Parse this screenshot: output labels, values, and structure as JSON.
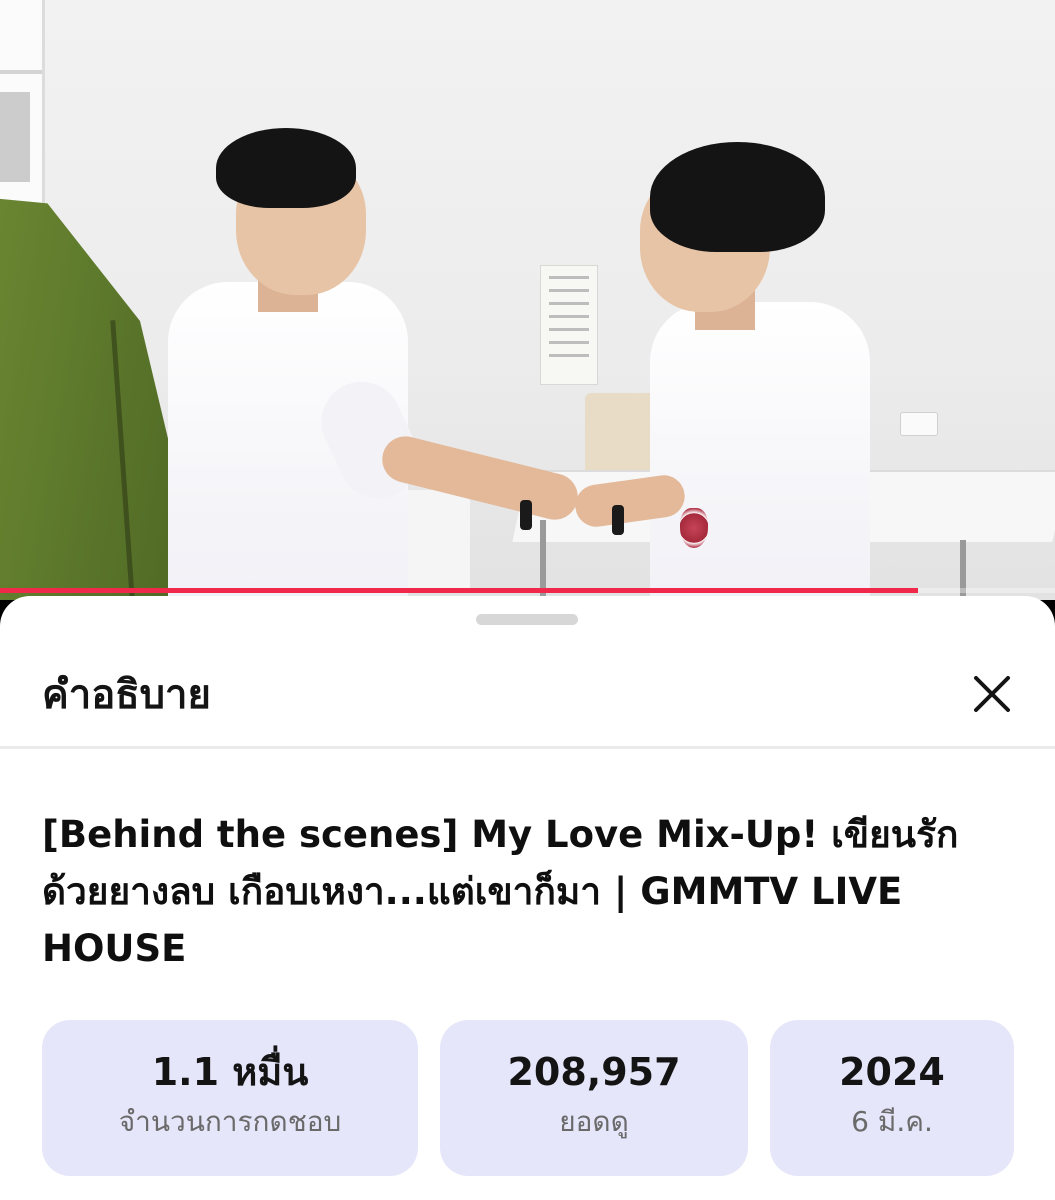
{
  "video": {
    "progress_fraction": 0.87,
    "progress_color": "#f0294b"
  },
  "sheet": {
    "title": "คำอธิบาย",
    "close_icon": "close-icon"
  },
  "description": {
    "title": "[Behind the scenes] My Love Mix-Up! เขียนรัก ด้วยยางลบ เกือบเหงา...แต่เขาก็มา | GMMTV LIVE HOUSE"
  },
  "stats": [
    {
      "value": "1.1 หมื่น",
      "label": "จำนวนการกดชอบ"
    },
    {
      "value": "208,957",
      "label": "ยอดดู"
    },
    {
      "value": "2024",
      "label": "6 มี.ค."
    }
  ],
  "colors": {
    "stat_card_bg": "#e6e6fb",
    "sheet_bg": "#ffffff"
  }
}
